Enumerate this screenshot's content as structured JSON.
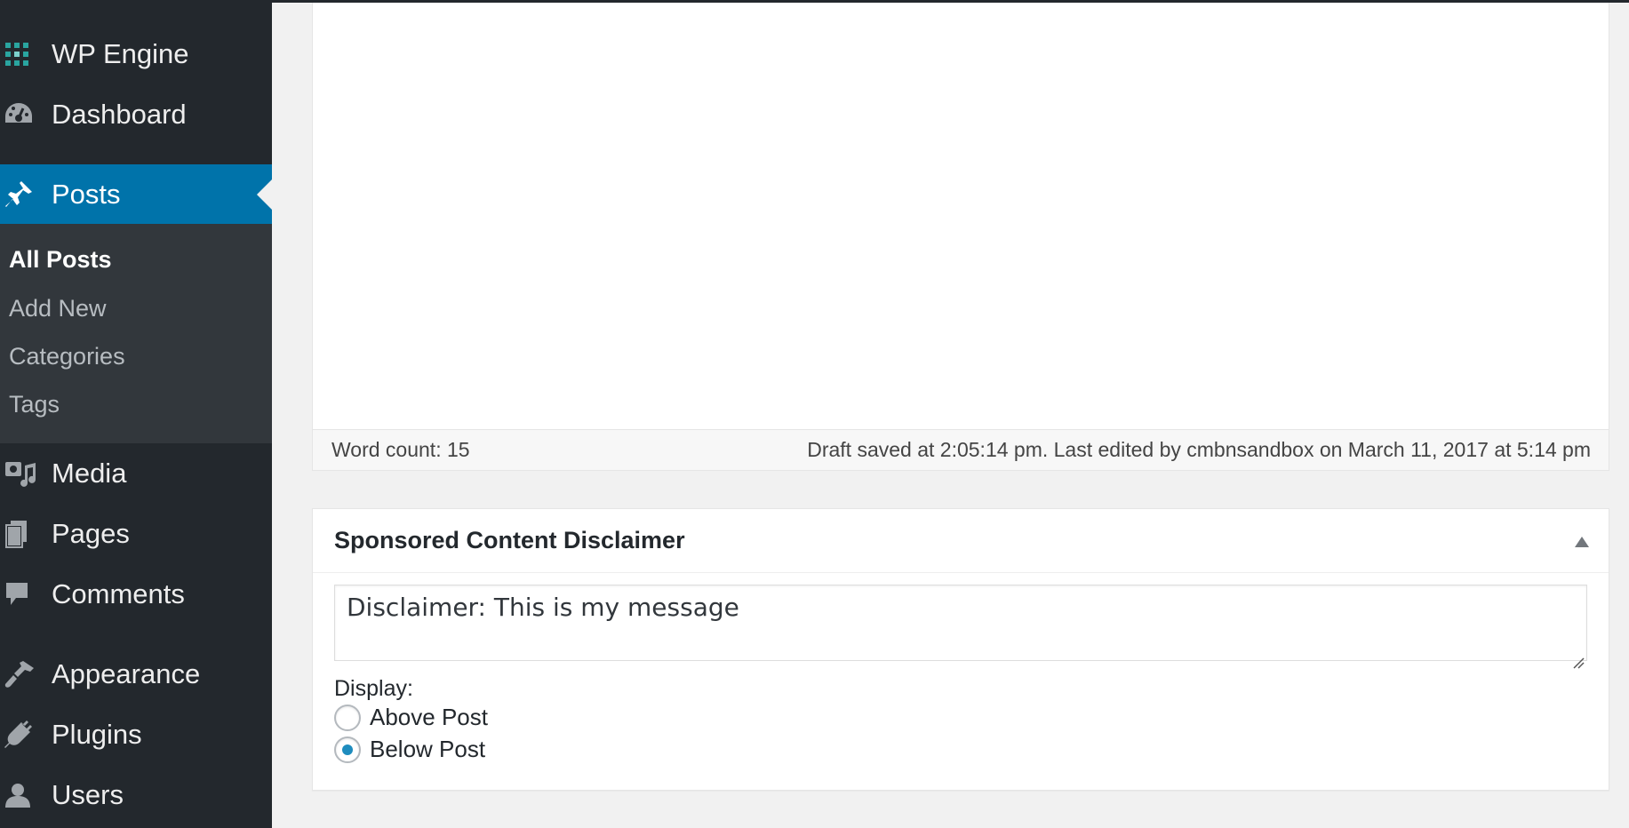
{
  "sidebar": {
    "items": [
      {
        "label": "WP Engine",
        "icon": "wp-engine-icon"
      },
      {
        "label": "Dashboard",
        "icon": "dashboard-gauge-icon"
      },
      {
        "label": "Posts",
        "icon": "pushpin-icon",
        "active": true
      },
      {
        "label": "Media",
        "icon": "media-icon"
      },
      {
        "label": "Pages",
        "icon": "pages-icon"
      },
      {
        "label": "Comments",
        "icon": "comment-bubble-icon"
      },
      {
        "label": "Appearance",
        "icon": "paintbrush-icon"
      },
      {
        "label": "Plugins",
        "icon": "plug-icon"
      },
      {
        "label": "Users",
        "icon": "user-icon"
      }
    ],
    "posts_submenu": [
      {
        "label": "All Posts",
        "current": true
      },
      {
        "label": "Add New"
      },
      {
        "label": "Categories"
      },
      {
        "label": "Tags"
      }
    ],
    "colors": {
      "background": "#23282d",
      "active": "#0073aa",
      "submenu": "#32373c"
    }
  },
  "editor": {
    "word_count": "Word count: 15",
    "draft_status": "Draft saved at 2:05:14 pm. Last edited by cmbnsandbox on March 11, 2017 at 5:14 pm"
  },
  "metabox": {
    "title": "Sponsored Content Disclaimer",
    "textarea_value": "Disclaimer: This is my message",
    "display_label": "Display:",
    "options": [
      {
        "label": "Above Post",
        "checked": false
      },
      {
        "label": "Below Post",
        "checked": true
      }
    ],
    "accent_color": "#1e8cbe"
  }
}
